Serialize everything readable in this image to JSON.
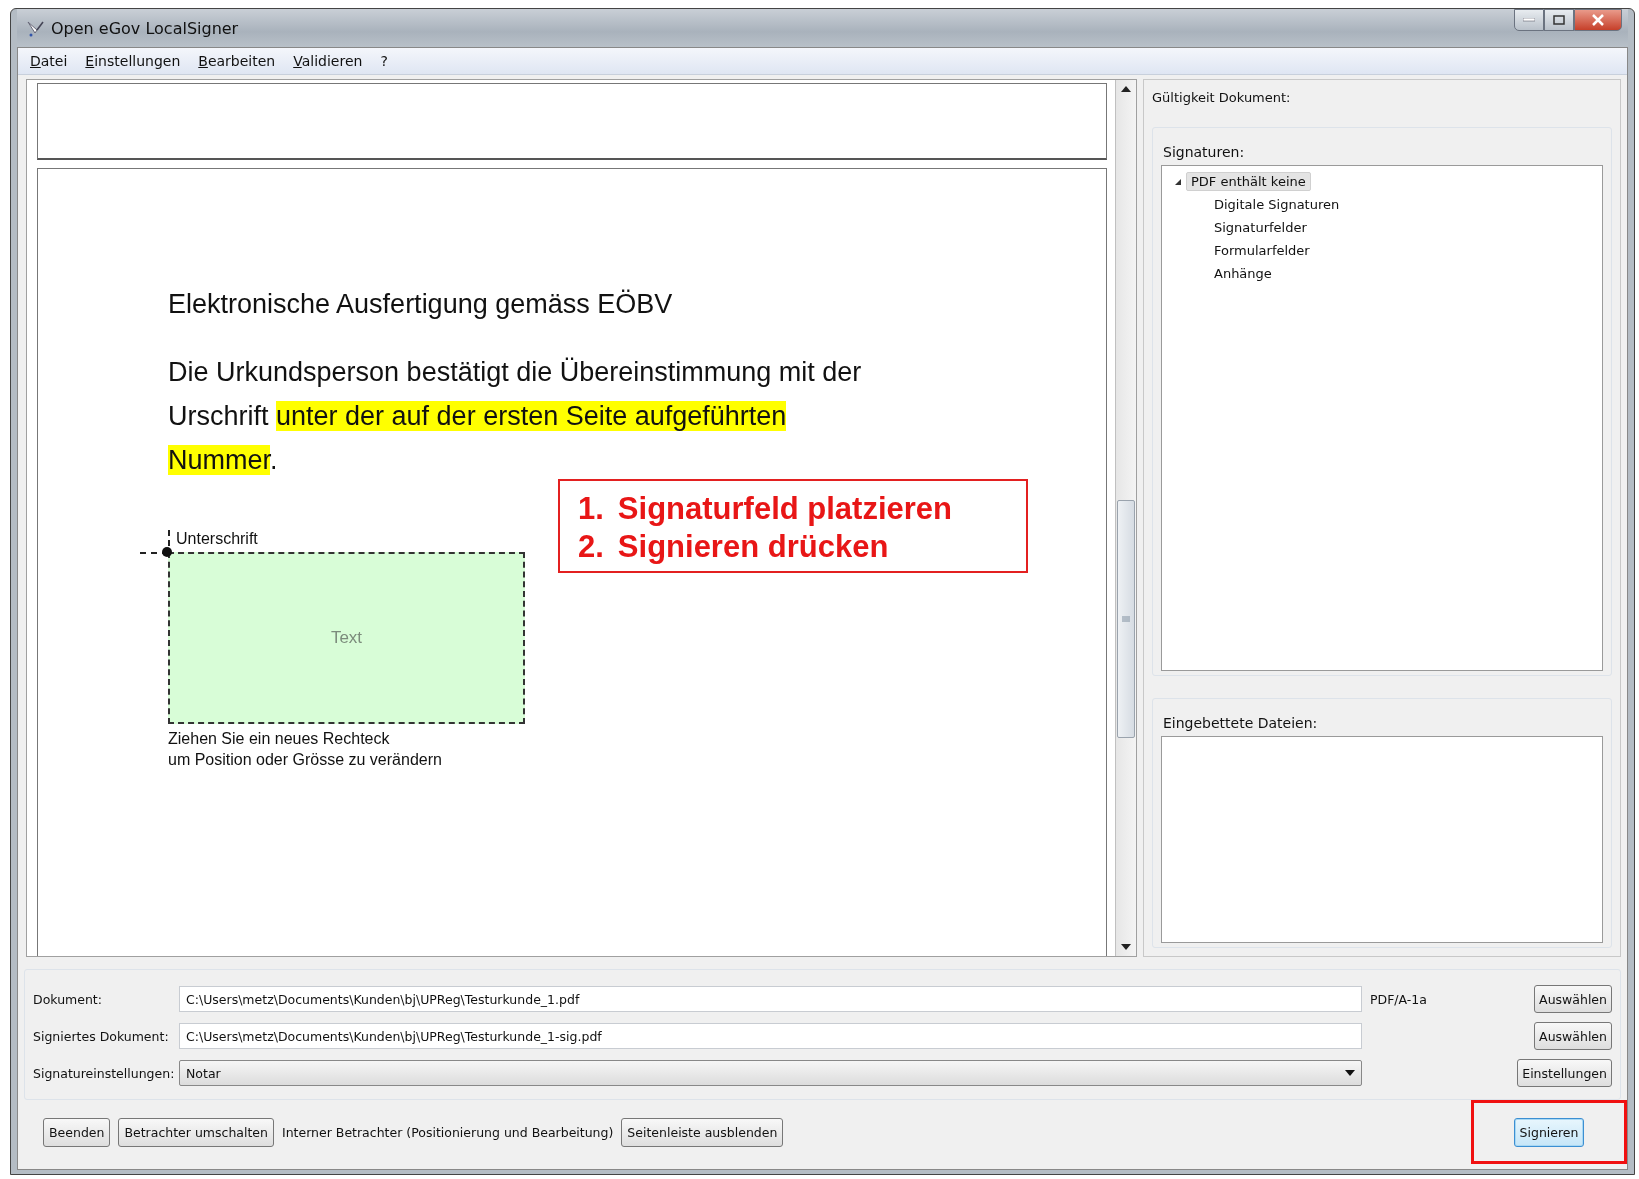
{
  "window": {
    "title": "Open eGov LocalSigner"
  },
  "menu": [
    {
      "label": "Datei",
      "mnemonic": true
    },
    {
      "label": "Einstellungen",
      "mnemonic": true
    },
    {
      "label": "Bearbeiten",
      "mnemonic": true
    },
    {
      "label": "Validieren",
      "mnemonic": true
    },
    {
      "label": "?",
      "mnemonic": false
    }
  ],
  "document": {
    "heading": "Elektronische Ausfertigung gemäss EÖBV",
    "lines": [
      [
        {
          "text": "Die Urkundsperson bestätigt die Übereinstimmung mit der",
          "highlighted": false
        }
      ],
      [
        {
          "text": "Urschrift ",
          "highlighted": false
        },
        {
          "text": "unter der auf der ersten Seite aufgeführten",
          "highlighted": true
        }
      ],
      [
        {
          "text": "Nummer",
          "highlighted": true
        },
        {
          "text": ".",
          "highlighted": false
        }
      ]
    ],
    "signature_field": {
      "label": "Unterschrift",
      "text": "Text",
      "hint_lines": [
        "Ziehen Sie ein neues Rechteck",
        "um Position oder Grösse zu verändern"
      ]
    },
    "callout": {
      "steps": [
        {
          "number": "1.",
          "text": "Signaturfeld platzieren"
        },
        {
          "number": "2.",
          "text": "Signieren drücken"
        }
      ]
    }
  },
  "sidebar": {
    "validity_label": "Gültigkeit Dokument:",
    "signatures": {
      "title": "Signaturen:",
      "tree": [
        {
          "label": "PDF enthält keine",
          "expanded": true,
          "selected": true,
          "children": [
            {
              "label": "Digitale Signaturen",
              "selected": false
            },
            {
              "label": "Signaturfelder",
              "selected": false
            },
            {
              "label": "Formularfelder",
              "selected": false
            },
            {
              "label": "Anhänge",
              "selected": false
            }
          ]
        }
      ]
    },
    "embedded_files": {
      "title": "Eingebettete Dateien:"
    }
  },
  "form": {
    "rows": [
      {
        "label": "Dokument:",
        "kind": "text",
        "value": "C:\\Users\\metz\\Documents\\Kunden\\bj\\UPReg\\Testurkunde_1.pdf",
        "note": "PDF/A-1a",
        "button": "Auswählen"
      },
      {
        "label": "Signiertes Dokument:",
        "kind": "text",
        "value": "C:\\Users\\metz\\Documents\\Kunden\\bj\\UPReg\\Testurkunde_1-sig.pdf",
        "button": "Auswählen"
      },
      {
        "label": "Signatureinstellungen:",
        "kind": "dropdown",
        "value": "Notar",
        "button": "Einstellungen"
      }
    ]
  },
  "actions": [
    {
      "kind": "button",
      "label": "Beenden"
    },
    {
      "kind": "button",
      "label": "Betrachter umschalten"
    },
    {
      "kind": "text",
      "label": "Interner Betrachter (Positionierung und Bearbeitung)"
    },
    {
      "kind": "button",
      "label": "Seitenleiste ausblenden"
    }
  ],
  "sign_button": {
    "label": "Signieren",
    "focused": true,
    "callout": true
  }
}
